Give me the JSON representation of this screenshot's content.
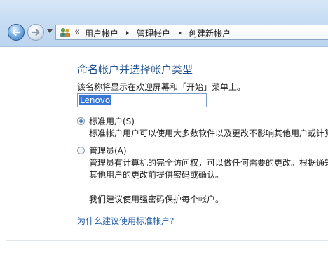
{
  "navigation": {
    "overflow": "«",
    "breadcrumbs": [
      "用户帐户",
      "管理帐户",
      "创建新帐户"
    ]
  },
  "page": {
    "title": "命名帐户并选择帐户类型",
    "prompt": "该名称将显示在欢迎屏幕和「开始」菜单上。",
    "name_value": "Lenovo"
  },
  "account_types": [
    {
      "label": "标准用户(S)",
      "selected": true,
      "description_lines": [
        "标准帐户用户可以使用大多数软件以及更改不影响其他用户或计算"
      ]
    },
    {
      "label": "管理员(A)",
      "selected": false,
      "description_lines": [
        "管理员有计算机的完全访问权，可以做任何需要的更改。根据通知",
        "其他用户的更改前提供密码或确认。"
      ]
    }
  ],
  "recommendation": "我们建议使用强密码保护每个帐户。",
  "help_link": "为什么建议使用标准帐户?",
  "colors": {
    "title": "#1e4e8c",
    "link": "#1e5aa8",
    "selection": "#3b78d5"
  }
}
